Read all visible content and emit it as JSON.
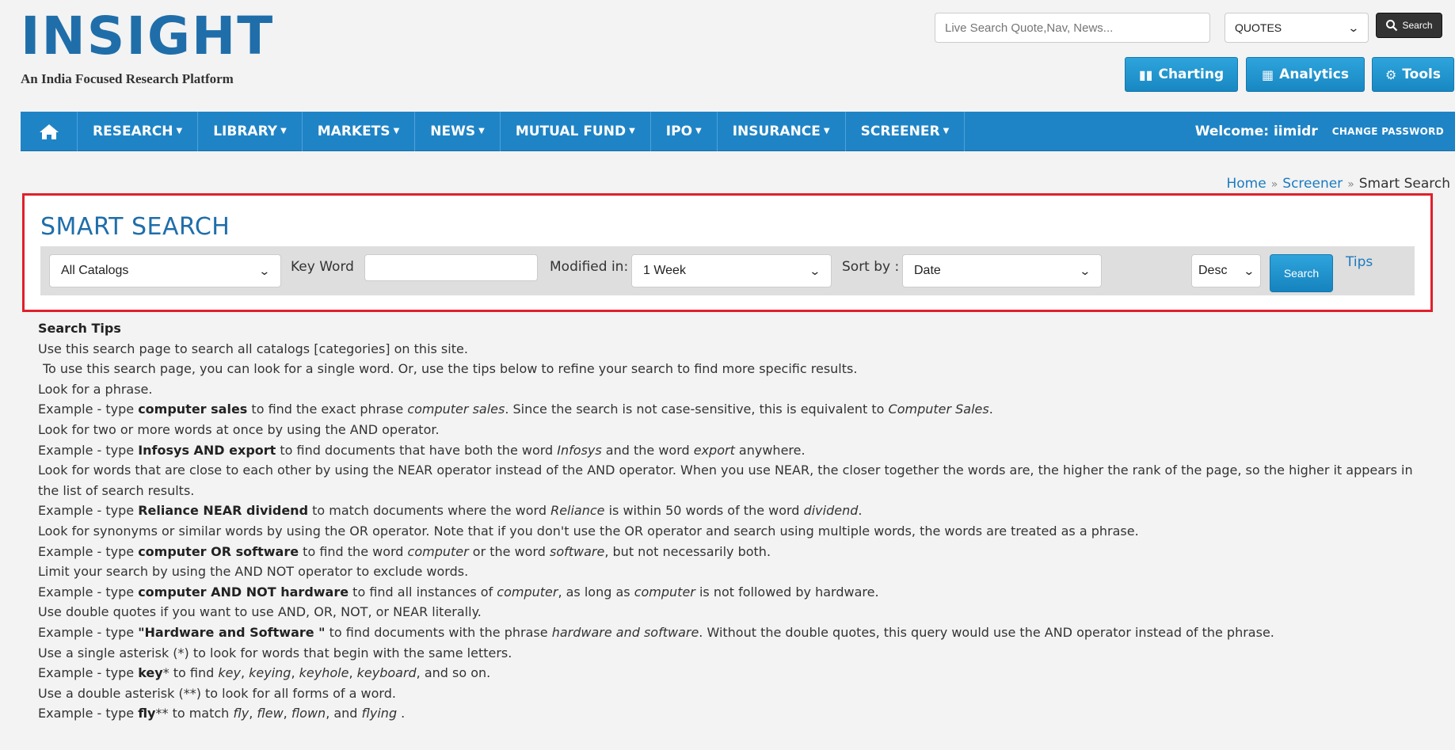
{
  "header": {
    "logo_title": "INSIGHT",
    "logo_tagline": "An India Focused Research Platform",
    "live_search_placeholder": "Live Search Quote,Nav, News...",
    "quote_type_selected": "QUOTES",
    "search_button_label": "Search",
    "tools": [
      {
        "label": "Charting",
        "icon": "chart-icon"
      },
      {
        "label": "Analytics",
        "icon": "analytics-icon"
      },
      {
        "label": "Tools",
        "icon": "gear-icon"
      }
    ]
  },
  "nav": {
    "items": [
      "RESEARCH",
      "LIBRARY",
      "MARKETS",
      "NEWS",
      "MUTUAL FUND",
      "IPO",
      "INSURANCE",
      "SCREENER"
    ],
    "welcome": "Welcome: iimidr",
    "change_password": "CHANGE PASSWORD"
  },
  "breadcrumb": {
    "home": "Home",
    "screener": "Screener",
    "current": "Smart Search"
  },
  "smart_search": {
    "title": "SMART SEARCH",
    "catalog_selected": "All Catalogs",
    "keyword_label": "Key Word",
    "keyword_value": "",
    "modified_label": "Modified in:",
    "modified_selected": "1 Week",
    "sort_label": "Sort by :",
    "sort_selected": "Date",
    "order_selected": "Desc",
    "search_button": "Search",
    "tips_link": "Tips"
  },
  "tips": {
    "heading": "Search Tips",
    "l1": "Use this search page to search all catalogs [categories] on this site.",
    "l2": "To use this search page, you can look for a single word. Or, use the tips below to refine your search to find more specific results.",
    "l3": "Look for a phrase.",
    "l4_a": "Example - type ",
    "l4_b": "computer sales",
    "l4_c": " to find the exact phrase ",
    "l4_d": "computer sales",
    "l4_e": ". Since the search is not case-sensitive, this is equivalent to ",
    "l4_f": "Computer Sales",
    "l4_g": ".",
    "l5": "Look for two or more words at once by using the AND operator.",
    "l6_a": "Example - type ",
    "l6_b": "Infosys AND export",
    "l6_c": " to find documents that have both the word ",
    "l6_d": "Infosys",
    "l6_e": " and the word ",
    "l6_f": "export",
    "l6_g": " anywhere.",
    "l7": "Look for words that are close to each other by using the NEAR operator instead of the AND operator. When you use NEAR, the closer together the words are, the higher the rank of the page, so the higher it appears in the list of search results.",
    "l8_a": "Example - type ",
    "l8_b": "Reliance NEAR dividend",
    "l8_c": " to match documents where the word ",
    "l8_d": "Reliance",
    "l8_e": " is within 50 words of the word ",
    "l8_f": "dividend",
    "l8_g": ".",
    "l9": "Look for synonyms or similar words by using the OR operator. Note that if you don't use the OR operator and search using multiple words, the words are treated as a phrase.",
    "l10_a": "Example - type ",
    "l10_b": "computer OR software",
    "l10_c": " to find the word ",
    "l10_d": "computer",
    "l10_e": " or the word ",
    "l10_f": "software",
    "l10_g": ", but not necessarily both.",
    "l11": "Limit your search by using the AND NOT operator to exclude words.",
    "l12_a": "Example - type ",
    "l12_b": "computer AND NOT hardware",
    "l12_c": " to find all instances of ",
    "l12_d": "computer",
    "l12_e": ", as long as ",
    "l12_f": "computer",
    "l12_g": " is not followed by hardware.",
    "l13": "Use double quotes if you want to use AND, OR, NOT, or NEAR literally.",
    "l14_a": "Example - type ",
    "l14_b": "\"Hardware and Software \"",
    "l14_c": " to find documents with the phrase ",
    "l14_d": "hardware and software",
    "l14_e": ". Without the double quotes, this query would use the AND operator instead of the phrase.",
    "l15": "Use a single asterisk (*) to look for words that begin with the same letters.",
    "l16_a": "Example - type ",
    "l16_b": "key",
    "l16_c": "* to find ",
    "l16_d": "key",
    "l16_e": ", ",
    "l16_f": "keying",
    "l16_g": ", ",
    "l16_h": "keyhole",
    "l16_i": ", ",
    "l16_j": "keyboard",
    "l16_k": ", and so on.",
    "l17": "Use a double asterisk (**) to look for all forms of a word.",
    "l18_a": "Example - type ",
    "l18_b": "fly",
    "l18_c": "** to match ",
    "l18_d": "fly",
    "l18_e": ", ",
    "l18_f": "flew",
    "l18_g": ", ",
    "l18_h": "flown",
    "l18_i": ", and ",
    "l18_j": "flying",
    "l18_k": " ."
  }
}
